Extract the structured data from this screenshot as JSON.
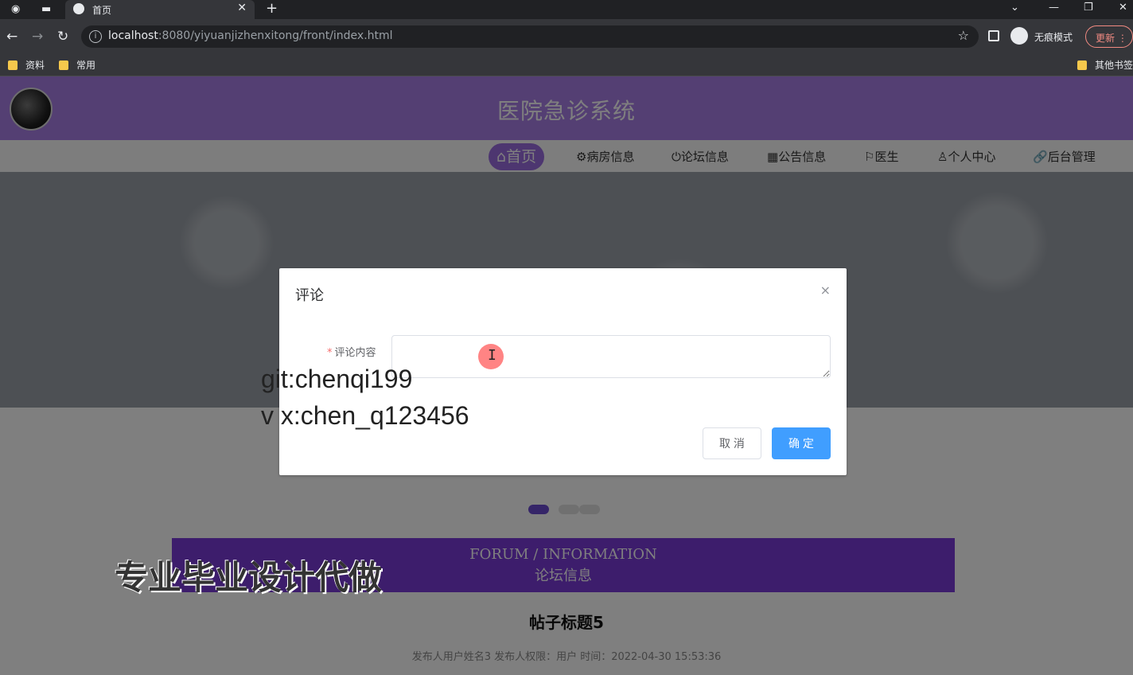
{
  "browser": {
    "tab_title": "首页",
    "new_tab_symbol": "+",
    "url_host": "localhost",
    "url_rest": ":8080/yiyuanjizhenxitong/front/index.html",
    "incognito_label": "无痕模式",
    "update_label": "更新",
    "bookmarks": [
      "资料",
      "常用"
    ],
    "other_bookmarks": "其他书签"
  },
  "site": {
    "title": "医院急诊系统",
    "nav": [
      {
        "label": "首页",
        "icon": "home-icon"
      },
      {
        "label": "病房信息",
        "icon": "gear-icon"
      },
      {
        "label": "论坛信息",
        "icon": "power-icon"
      },
      {
        "label": "公告信息",
        "icon": "grid-icon"
      },
      {
        "label": "医生",
        "icon": "flag-icon"
      },
      {
        "label": "个人中心",
        "icon": "user-icon"
      },
      {
        "label": "后台管理",
        "icon": "link-icon"
      }
    ],
    "nav_icons": {
      "home": "⌂",
      "gear": "⚙",
      "power": "⏻",
      "grid": "▦",
      "flag": "⚐",
      "user": "♙",
      "link": "🔗"
    }
  },
  "forum": {
    "heading_en": "FORUM / INFORMATION",
    "heading_cn": "论坛信息",
    "post_title": "帖子标题5",
    "post_meta": "发布人用户姓名3   发布人权限：用户   时间：2022-04-30 15:53:36"
  },
  "dialog": {
    "title": "评论",
    "close_symbol": "×",
    "field_label": "评论内容",
    "required_mark": "*",
    "textarea_value": "",
    "cancel_label": "取 消",
    "ok_label": "确 定"
  },
  "watermarks": {
    "line1": "git:chenqi199",
    "line2": "v x:chen_q123456",
    "line3": "专业毕业设计代做"
  },
  "colors": {
    "header_purple": "#a97fe6",
    "nav_active": "#9b6ce0",
    "forum_purple": "#7b3bd9",
    "primary_button": "#409eff"
  }
}
